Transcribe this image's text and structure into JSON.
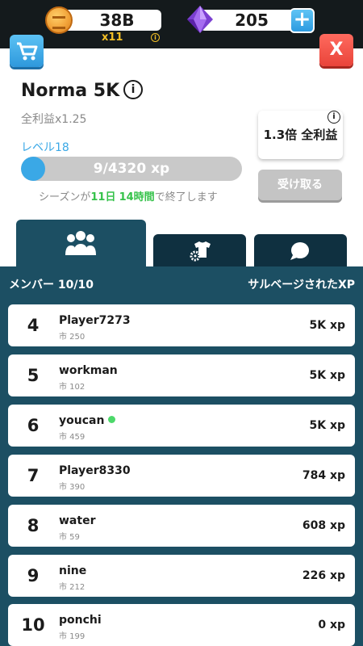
{
  "currency": {
    "coins": "38B",
    "multiplier": "x11",
    "info_symbol": "i",
    "gems": "205",
    "plus_label": "+"
  },
  "nav": {
    "close_label": "X"
  },
  "club": {
    "name": "Norma 5K",
    "info_symbol": "i",
    "profit_bonus": "全利益x1.25",
    "level": "レベル18",
    "xp": "9/4320 xp",
    "xp_progress": 0.002,
    "season_prefix": "シーズンが",
    "season_days": "11日",
    "season_hours": "14時間",
    "season_suffix": "で終了します",
    "bonus_label": "1.3倍 全利益",
    "bonus_info_symbol": "i",
    "claim_label": "受け取る"
  },
  "tabs": [
    {
      "icon": "members-icon",
      "active": true
    },
    {
      "icon": "shirt-gear-icon",
      "active": false
    },
    {
      "icon": "chat-bubble-icon",
      "active": false
    }
  ],
  "members": {
    "count_label": "メンバー 10/10",
    "xp_header": "サルベージされたXP",
    "rows": [
      {
        "rank": "4",
        "name": "Player7273",
        "city": "市 250",
        "xp": "5K xp",
        "online": false
      },
      {
        "rank": "5",
        "name": "workman",
        "city": "市 102",
        "xp": "5K xp",
        "online": false
      },
      {
        "rank": "6",
        "name": "youcan",
        "city": "市 459",
        "xp": "5K xp",
        "online": true
      },
      {
        "rank": "7",
        "name": "Player8330",
        "city": "市 390",
        "xp": "784 xp",
        "online": false
      },
      {
        "rank": "8",
        "name": "water",
        "city": "市 59",
        "xp": "608 xp",
        "online": false
      },
      {
        "rank": "9",
        "name": "nine",
        "city": "市 212",
        "xp": "226 xp",
        "online": false
      },
      {
        "rank": "10",
        "name": "ponchi",
        "city": "市 199",
        "xp": "0 xp",
        "online": false
      }
    ]
  },
  "colors": {
    "accent_blue": "#3aa8e6",
    "panel_teal": "#1c4f63",
    "close_red": "#e9443a",
    "online_green": "#4cd86a",
    "season_green": "#35c24a",
    "coin_gold": "#f4c026"
  }
}
